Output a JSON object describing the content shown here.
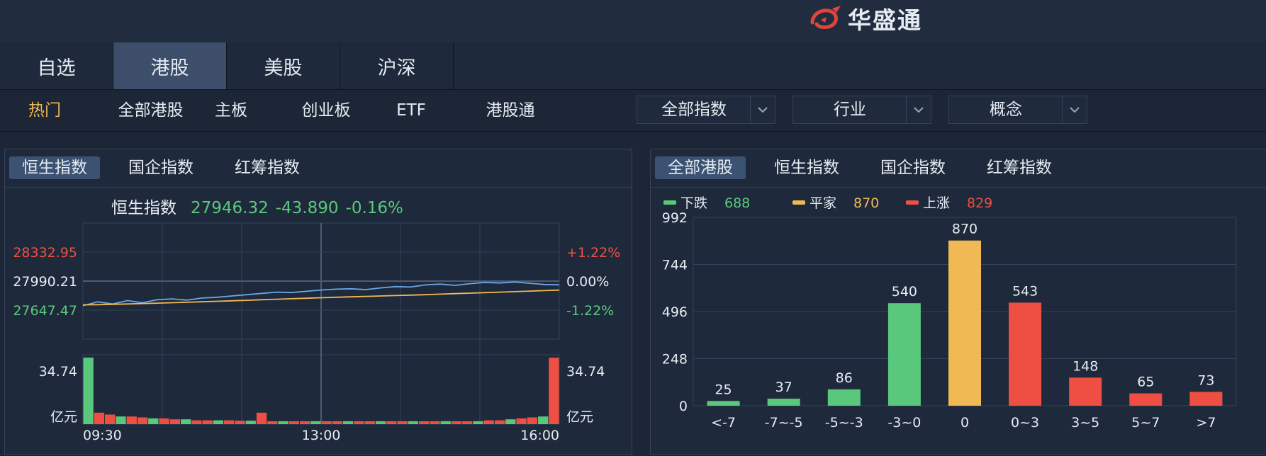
{
  "brand": {
    "name": "华盛通",
    "logo_color": "#e0443d"
  },
  "main_tabs": [
    "自选",
    "港股",
    "美股",
    "沪深"
  ],
  "main_tab_active": 1,
  "sub_tabs": [
    "热门",
    "全部港股",
    "主板",
    "创业板",
    "ETF",
    "港股通"
  ],
  "sub_tab_active": 0,
  "dropdowns": [
    "全部指数",
    "行业",
    "概念"
  ],
  "colors": {
    "up": "#ef4e42",
    "down": "#5ac87c",
    "flat": "#f0b953",
    "accent": "#f0b953",
    "price_line": "#6aa6e6"
  },
  "left_panel": {
    "tabs": [
      "恒生指数",
      "国企指数",
      "红筹指数"
    ],
    "active_tab": 0,
    "quote": {
      "name": "恒生指数",
      "price": "27946.32",
      "change": "-43.890",
      "change_pct": "-0.16%"
    }
  },
  "right_panel": {
    "tabs": [
      "全部港股",
      "恒生指数",
      "国企指数",
      "红筹指数"
    ],
    "active_tab": 0,
    "legend": [
      {
        "label": "下跌",
        "value": "688",
        "color": "#5ac87c"
      },
      {
        "label": "平家",
        "value": "870",
        "color": "#f0b953"
      },
      {
        "label": "上涨",
        "value": "829",
        "color": "#ef4e42"
      }
    ]
  },
  "chart_data": [
    {
      "type": "line",
      "y_ticks_left": [
        "28332.95",
        "27990.21",
        "27647.47"
      ],
      "y_ticks_right": [
        "+1.22%",
        "0.00%",
        "-1.22%"
      ],
      "ylim": [
        27647.47,
        28332.95
      ],
      "x_ticks": [
        "09:30",
        "13:00",
        "16:00"
      ],
      "series": [
        {
          "values": [
            27700,
            27745,
            27720,
            27760,
            27735,
            27770,
            27780,
            27765,
            27790,
            27800,
            27815,
            27830,
            27845,
            27860,
            27855,
            27870,
            27885,
            27895,
            27900,
            27890,
            27910,
            27925,
            27920,
            27945,
            27955,
            27940,
            27960,
            27975,
            27968,
            27980,
            27965,
            27950,
            27946
          ]
        },
        {
          "values": [
            27710,
            27712,
            27716,
            27720,
            27725,
            27730,
            27735,
            27740,
            27746,
            27752,
            27758,
            27764,
            27770,
            27776,
            27782,
            27788,
            27794,
            27800,
            27805,
            27810,
            27815,
            27820,
            27825,
            27830,
            27836,
            27842,
            27848,
            27854,
            27860,
            27866,
            27872,
            27878,
            27884
          ]
        }
      ],
      "volume_max_label": "34.74",
      "volume_unit": "亿元",
      "volume": [
        34.7,
        6,
        5,
        4,
        4,
        3.5,
        3,
        3,
        2.5,
        2.5,
        2,
        2,
        2,
        2,
        1.8,
        1.8,
        6,
        1.5,
        1.5,
        1.5,
        1.5,
        1.5,
        1.5,
        1.5,
        1.5,
        1.5,
        1.5,
        1.5,
        1.5,
        1.5,
        1.5,
        1.5,
        1.5,
        1.5,
        1.5,
        1.5,
        1.5,
        2,
        2,
        2.5,
        3,
        3.5,
        4,
        34.7
      ]
    },
    {
      "type": "bar",
      "categories": [
        "<-7",
        "-7~-5",
        "-5~-3",
        "-3~0",
        "0",
        "0~3",
        "3~5",
        "5~7",
        ">7"
      ],
      "values": [
        25,
        37,
        86,
        540,
        870,
        543,
        148,
        65,
        73
      ],
      "y_ticks": [
        "992",
        "744",
        "496",
        "248",
        "0"
      ],
      "ylim": [
        0,
        992
      ],
      "bar_colors": [
        "#5ac87c",
        "#5ac87c",
        "#5ac87c",
        "#5ac87c",
        "#f0b953",
        "#ef4e42",
        "#ef4e42",
        "#ef4e42",
        "#ef4e42"
      ]
    }
  ]
}
